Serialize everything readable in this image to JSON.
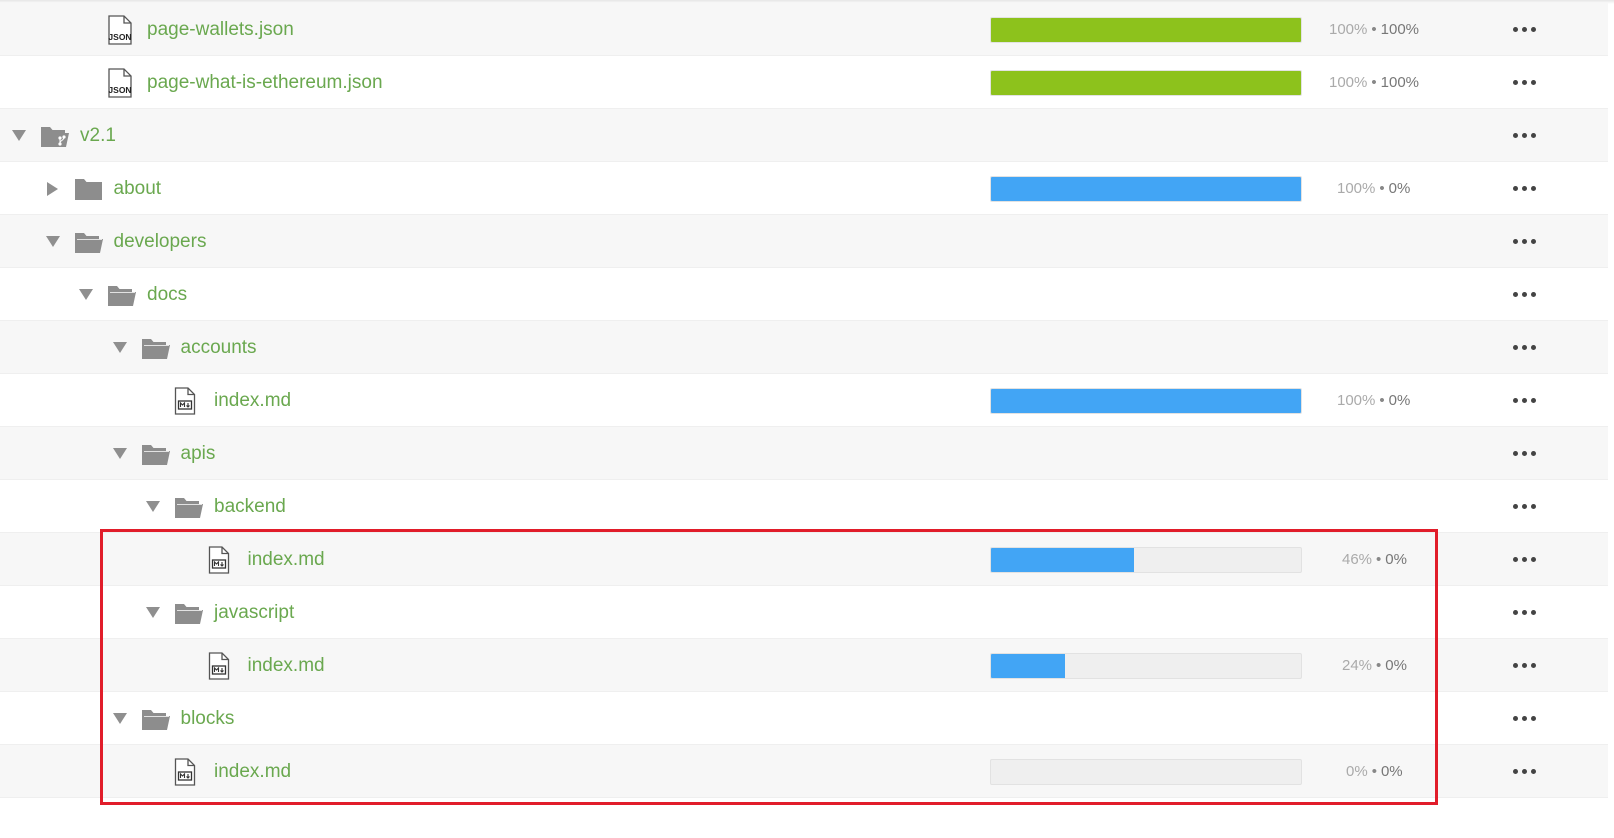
{
  "colors": {
    "green_bar": "#8dc21c",
    "blue_bar": "#42a5f5",
    "link_green": "#6aa84f",
    "highlight_red": "#e11d2a"
  },
  "rows": [
    {
      "name": "page-wallets.json",
      "icon": "json-file-icon",
      "depth": 2,
      "bar": {
        "color": "green",
        "fraction": 1.0
      },
      "translated": "100%",
      "approved": "100%"
    },
    {
      "name": "page-what-is-ethereum.json",
      "icon": "json-file-icon",
      "depth": 2,
      "bar": {
        "color": "green",
        "fraction": 1.0
      },
      "translated": "100%",
      "approved": "100%"
    },
    {
      "name": "v2.1",
      "icon": "folder-branch-open-icon",
      "depth": 0,
      "caret": "down"
    },
    {
      "name": "about",
      "icon": "folder-closed-icon",
      "depth": 1,
      "caret": "right",
      "bar": {
        "color": "blue",
        "fraction": 1.0
      },
      "translated": "100%",
      "approved": "0%"
    },
    {
      "name": "developers",
      "icon": "folder-open-icon",
      "depth": 1,
      "caret": "down"
    },
    {
      "name": "docs",
      "icon": "folder-open-icon",
      "depth": 2,
      "caret": "down"
    },
    {
      "name": "accounts",
      "icon": "folder-open-icon",
      "depth": 3,
      "caret": "down"
    },
    {
      "name": "index.md",
      "icon": "markdown-file-icon",
      "depth": 4,
      "bar": {
        "color": "blue",
        "fraction": 1.0
      },
      "translated": "100%",
      "approved": "0%"
    },
    {
      "name": "apis",
      "icon": "folder-open-icon",
      "depth": 3,
      "caret": "down"
    },
    {
      "name": "backend",
      "icon": "folder-open-icon",
      "depth": 4,
      "caret": "down"
    },
    {
      "name": "index.md",
      "icon": "markdown-file-icon",
      "depth": 5,
      "bar": {
        "color": "blue",
        "fraction": 0.46
      },
      "translated": "46%",
      "approved": "0%"
    },
    {
      "name": "javascript",
      "icon": "folder-open-icon",
      "depth": 4,
      "caret": "down"
    },
    {
      "name": "index.md",
      "icon": "markdown-file-icon",
      "depth": 5,
      "bar": {
        "color": "blue",
        "fraction": 0.24
      },
      "translated": "24%",
      "approved": "0%"
    },
    {
      "name": "blocks",
      "icon": "folder-open-icon",
      "depth": 3,
      "caret": "down"
    },
    {
      "name": "index.md",
      "icon": "markdown-file-icon",
      "depth": 4,
      "bar": {
        "color": "blue",
        "fraction": 0.0
      },
      "translated": "0%",
      "approved": "0%"
    }
  ]
}
